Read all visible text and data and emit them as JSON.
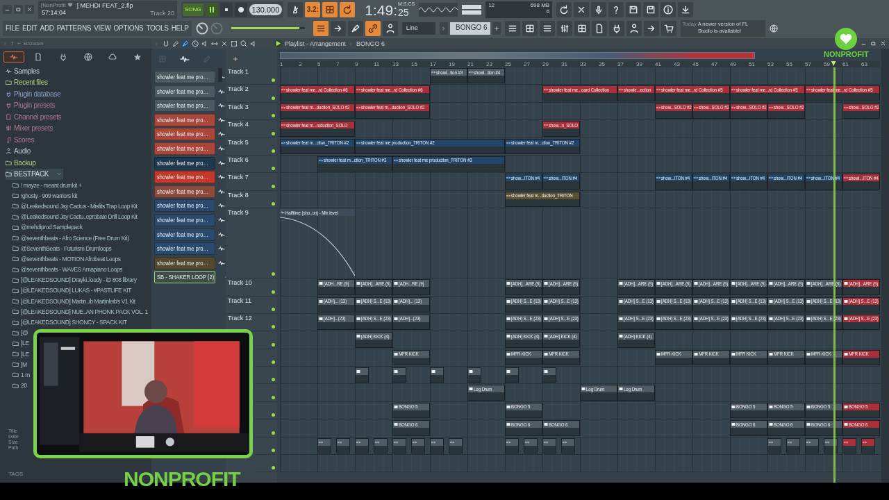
{
  "window": {
    "project": "[NonProfit",
    "elapsed": "57:14:04",
    "file": "] MEHDI FEAT_2.flp",
    "hint": "Track 20"
  },
  "window_controls": [
    {
      "kind": "minimize"
    },
    {
      "kind": "restore"
    },
    {
      "kind": "close"
    }
  ],
  "transport": {
    "mode": "SONG",
    "song_mode": true,
    "playing": true,
    "recording": false,
    "tempo": "130.000",
    "time": "1:49:",
    "time_cs": "25",
    "time_unit": "M:S:CS"
  },
  "record_tools": [
    {
      "on": false
    },
    {
      "on": true,
      "label": "3.2:"
    },
    {
      "on": true
    },
    {
      "on": true
    }
  ],
  "monitor": {
    "cpu": "12",
    "memory": "698 MB",
    "polyphony": "6"
  },
  "system_tools": [
    {
      "kind": "refresh"
    },
    {
      "kind": "scissors"
    },
    {
      "kind": "mic"
    },
    {
      "kind": "question"
    },
    {
      "kind": "disk"
    },
    {
      "kind": "disk"
    },
    {
      "kind": "info"
    },
    {
      "kind": "download"
    }
  ],
  "menu": [
    "FILE",
    "EDIT",
    "ADD",
    "PATTERNS",
    "VIEW",
    "OPTIONS",
    "TOOLS",
    "HELP"
  ],
  "master_pitch": {
    "level": 0.93
  },
  "pattern_tools": [
    {
      "on": true
    },
    {
      "on": false
    },
    {
      "on": false
    },
    {
      "on": true
    },
    {
      "on": false
    }
  ],
  "snap": "Line",
  "pattern": "BONGO 6",
  "window_tools": [
    {
      "kind": "list"
    },
    {
      "kind": "grid"
    },
    {
      "kind": "list"
    },
    {
      "kind": "sliders"
    },
    {
      "kind": "grid"
    },
    {
      "kind": "doc"
    },
    {
      "kind": "plug"
    },
    {
      "kind": "person"
    },
    {
      "kind": "arrow"
    },
    {
      "kind": "cart"
    }
  ],
  "hint": {
    "day": "Today",
    "message": "A newer version of FL Studio is available!"
  },
  "logo": {
    "text": "NONPROFIT"
  },
  "browser": {
    "title": "Browser",
    "tabs": [
      {
        "kind": "wave",
        "selected": true
      },
      {
        "kind": "doc",
        "selected": false
      },
      {
        "kind": "plug",
        "selected": false
      },
      {
        "kind": "globe",
        "selected": false
      },
      {
        "kind": "cloud",
        "selected": false
      },
      {
        "kind": "star",
        "selected": false
      }
    ],
    "items": [
      {
        "label": "Samples",
        "kind": "samples"
      },
      {
        "label": "Recent files",
        "kind": "recent"
      },
      {
        "label": "Plugin database",
        "kind": "plugin_database"
      },
      {
        "label": "Plugin presets",
        "kind": "plugin_presets"
      },
      {
        "label": "Channel presets",
        "kind": "channel_presets"
      },
      {
        "label": "Mixer presets",
        "kind": "mixer_presets"
      },
      {
        "label": "Scores",
        "kind": "scores"
      },
      {
        "label": "Audio",
        "kind": "audio"
      },
      {
        "label": "Backup",
        "kind": "backup"
      },
      {
        "label": "BESTPACK",
        "kind": "folder",
        "expanded": true,
        "children": [
          {
            "label": "! mayze - meant drumkit +"
          },
          {
            "label": "!ghosty - 909 warriors kit"
          },
          {
            "label": "@Leakedsound Jay Cactus - Misfits Trap Loop Kit"
          },
          {
            "label": "@Leakedsound Jay Cactu..eprobate Drill Loop Kit"
          },
          {
            "label": "@mehdiprod Samplepack"
          },
          {
            "label": "@seventhbeats - Afro Science (Free Drum Kit)"
          },
          {
            "label": "@SeventhBeats - Futurism Drumloops"
          },
          {
            "label": "@seventhbeats - MOTION Afrobeat Loops"
          },
          {
            "label": "@seventhbeats - WAVES Amapiano Loops"
          },
          {
            "label": "[@LEAKEDSOUND] Drayki..loody - iD 808 library"
          },
          {
            "label": "[@LEAKEDSOUND] LUKAS - #PASTLIFE KIT"
          },
          {
            "label": "[@LEAKEDSOUND] Martin..ib Martinleib's V1 Kit"
          },
          {
            "label": "[@LEAKEDSOUND] NUE..AN PHONK PACK VOL. 1"
          },
          {
            "label": "[@LEAKEDSOUND] SHONCY - SPACK KIT"
          },
          {
            "label": "[@"
          },
          {
            "label": "[LE"
          },
          {
            "label": "[LE"
          },
          {
            "label": "[M"
          },
          {
            "label": "1 m"
          },
          {
            "label": "20"
          }
        ]
      }
    ],
    "info": [
      "Title",
      "Date",
      "Size",
      "Path"
    ],
    "tags": "TAGS"
  },
  "playlist": {
    "title": "Playlist - Arrangement",
    "pattern": "BONGO 6",
    "tools": [
      {
        "kind": "magnet",
        "selected": false
      },
      {
        "kind": "pencil",
        "selected": false
      },
      {
        "kind": "brush",
        "selected": true
      },
      {
        "kind": "ban",
        "selected": false
      },
      {
        "kind": "speaker",
        "selected": false
      },
      {
        "kind": "slip",
        "selected": false
      },
      {
        "kind": "scissors",
        "selected": false
      },
      {
        "kind": "select",
        "selected": false
      },
      {
        "kind": "zoom",
        "selected": false
      },
      {
        "kind": "speaker",
        "selected": false
      }
    ],
    "ruler": [
      "1",
      "3",
      "5",
      "7",
      "9",
      "11",
      "13",
      "15",
      "17",
      "19",
      "21",
      "23",
      "25",
      "27",
      "29",
      "31",
      "33",
      "35",
      "37",
      "39",
      "41",
      "43",
      "45",
      "47",
      "49",
      "51",
      "53",
      "55",
      "57",
      "59",
      "61",
      "63"
    ],
    "playhead": {
      "level": 0.922
    },
    "channels": [
      {
        "name": "showler feat me pro…",
        "color": "#4a5a60",
        "selected": false
      },
      {
        "name": "showler feat me pro…",
        "color": "#4a5a60",
        "selected": false
      },
      {
        "name": "showler feat me pro…",
        "color": "#4a5a60",
        "selected": false
      },
      {
        "name": "showler feat me pro…",
        "color": "#a9473a",
        "selected": false
      },
      {
        "name": "showler feat me pro…",
        "color": "#a9473a",
        "selected": false
      },
      {
        "name": "showler feat me pro…",
        "color": "#a9473a",
        "selected": false
      },
      {
        "name": "showler feat me pro…",
        "color": "#1f3950",
        "selected": false
      },
      {
        "name": "showler feat me pro…",
        "color": "#c2372c",
        "selected": false
      },
      {
        "name": "showler feat me pro…",
        "color": "#8c4a3c",
        "selected": false
      },
      {
        "name": "showler feat me pro…",
        "color": "#294a6c",
        "selected": false
      },
      {
        "name": "showler feat me pro…",
        "color": "#294a6c",
        "selected": false
      },
      {
        "name": "showler feat me pro…",
        "color": "#294a6c",
        "selected": false
      },
      {
        "name": "showler feat me pro…",
        "color": "#294a6c",
        "selected": false
      },
      {
        "name": "showler feat me pro…",
        "color": "#54492f",
        "selected": false
      },
      {
        "name": "SB - SHAKER LOOP (2)",
        "color": "#3f4d4a",
        "selected": true
      }
    ],
    "tracks": [
      {
        "label": "Track 1",
        "active": true,
        "clips": [
          {
            "kind": "audio",
            "label": "showl...tion #3",
            "color": "#505c64"
          },
          {
            "kind": "audio",
            "label": "showl...tion #4",
            "color": "#505c64"
          }
        ]
      },
      {
        "label": "Track 2",
        "active": true,
        "clips": [
          {
            "kind": "audio",
            "label": "showler feat me...rd Collection #6",
            "color": "#a8303a"
          },
          {
            "kind": "audio",
            "label": "showler feat me...rd Collection #6",
            "color": "#a8303a"
          },
          {
            "kind": "audio",
            "label": "showler feat me...oard Collection",
            "color": "#a8303a"
          },
          {
            "kind": "audio",
            "label": "showle...ection",
            "color": "#a8303a"
          },
          {
            "kind": "audio",
            "label": "showler feat me...rd Collection #5",
            "color": "#a8303a"
          },
          {
            "kind": "audio",
            "label": "showler feat me...rd Collection #5",
            "color": "#a8303a"
          },
          {
            "kind": "audio",
            "label": "showler feat me...rd Collection #5",
            "color": "#a8303a"
          }
        ]
      },
      {
        "label": "Track 3",
        "active": true,
        "clips": [
          {
            "kind": "audio",
            "label": "showler feat m...duction_SOLO #2",
            "color": "#a8303a"
          },
          {
            "kind": "audio",
            "label": "showler feat m...duction_SOLO #2",
            "color": "#a8303a"
          },
          {
            "kind": "audio",
            "label": "show...SOLO #2",
            "color": "#a8303a"
          },
          {
            "kind": "audio",
            "label": "show...SOLO #2",
            "color": "#a8303a"
          },
          {
            "kind": "audio",
            "label": "show...SOLO #2",
            "color": "#a8303a"
          },
          {
            "kind": "audio",
            "label": "show...SOLO #2",
            "color": "#a8303a"
          },
          {
            "kind": "audio",
            "label": "show...SOLO #2",
            "color": "#a8303a"
          }
        ]
      },
      {
        "label": "Track 4",
        "active": true,
        "clips": [
          {
            "kind": "audio",
            "label": "showler feat m...roduction_SOLO",
            "color": "#a8303a"
          },
          {
            "kind": "audio",
            "label": "show...n_SOLO",
            "color": "#a8303a"
          }
        ]
      },
      {
        "label": "Track 5",
        "active": true,
        "clips": [
          {
            "kind": "audio",
            "label": "showler feat m...ction_TRITON #2",
            "color": "#22456a"
          },
          {
            "kind": "audio",
            "label": "showler feat me production_TRITON #2",
            "color": "#22456a"
          },
          {
            "kind": "audio",
            "label": "showler feat m...ction_TRITON #2",
            "color": "#22456a"
          }
        ]
      },
      {
        "label": "Track 6",
        "active": true,
        "clips": [
          {
            "kind": "audio",
            "label": "showler feat m...ction_TRITON #3",
            "color": "#22456a"
          },
          {
            "kind": "audio",
            "label": "showler feat me production_TRITON #3",
            "color": "#22456a"
          }
        ]
      },
      {
        "label": "Track 7",
        "active": true,
        "clips": [
          {
            "kind": "audio",
            "label": "show...ITON #4",
            "color": "#22456a"
          },
          {
            "kind": "audio",
            "label": "show...ITON #4",
            "color": "#22456a"
          },
          {
            "kind": "audio",
            "label": "show...ITON #4",
            "color": "#22456a"
          },
          {
            "kind": "audio",
            "label": "show...ITON #4",
            "color": "#22456a"
          },
          {
            "kind": "audio",
            "label": "show...ITON #4",
            "color": "#22456a"
          },
          {
            "kind": "audio",
            "label": "show...ITON #4",
            "color": "#22456a"
          },
          {
            "kind": "audio",
            "label": "show...ITON #4",
            "color": "#22456a"
          },
          {
            "kind": "audio",
            "label": "showl...ITON #4",
            "color": "#a8303a"
          }
        ]
      },
      {
        "label": "Track 8",
        "active": true,
        "clips": [
          {
            "kind": "audio",
            "label": "showler feat m...duction_TRITON",
            "color": "#5e5034"
          }
        ]
      },
      {
        "label": "Track 9",
        "kind": "automation",
        "active": true,
        "clips": [
          {
            "kind": "automation",
            "label": "Halftime (sho..on) - Mix level",
            "color": "#3c4c58"
          }
        ]
      },
      {
        "label": "Track 10",
        "active": true,
        "clips": [
          {
            "kind": "pattern",
            "label": "[ADH...RE (9)",
            "color": "#505c64"
          },
          {
            "kind": "pattern",
            "label": "[ADH]...ARE (9)",
            "color": "#505c64"
          },
          {
            "kind": "pattern",
            "label": "[ADH...RE (9)",
            "color": "#505c64"
          },
          {
            "kind": "pattern",
            "label": "[ADH]...ARE (9)",
            "color": "#505c64"
          },
          {
            "kind": "pattern",
            "label": "[ADH]...ARE (9)",
            "color": "#505c64"
          },
          {
            "kind": "pattern",
            "label": "[ADH]...ARE (9)",
            "color": "#505c64"
          },
          {
            "kind": "pattern",
            "label": "[ADH]...ARE (9)",
            "color": "#505c64"
          },
          {
            "kind": "pattern",
            "label": "[ADH]...ARE (9)",
            "color": "#505c64"
          },
          {
            "kind": "pattern",
            "label": "[ADH]...ARE (9)",
            "color": "#505c64"
          },
          {
            "kind": "pattern",
            "label": "[ADH]...ARE (9)",
            "color": "#505c64"
          },
          {
            "kind": "pattern",
            "label": "[ADH]...ARE (9)",
            "color": "#505c64"
          },
          {
            "kind": "pattern",
            "label": "[ADH]...ARE (9)",
            "color": "#a8303a"
          }
        ]
      },
      {
        "label": "Track 11",
        "active": true,
        "clips": [
          {
            "kind": "pattern",
            "label": "[ADH]... (13)",
            "color": "#505c64"
          },
          {
            "kind": "pattern",
            "label": "[ADH] S...E (13)",
            "color": "#505c64"
          },
          {
            "kind": "pattern",
            "label": "[ADH]... (13)",
            "color": "#505c64"
          },
          {
            "kind": "pattern",
            "label": "[ADH] S...E (13)",
            "color": "#505c64"
          },
          {
            "kind": "pattern",
            "label": "[ADH] S...E (13)",
            "color": "#505c64"
          },
          {
            "kind": "pattern",
            "label": "[ADH] S...E (13)",
            "color": "#505c64"
          },
          {
            "kind": "pattern",
            "label": "[ADH] S...E (13)",
            "color": "#505c64"
          },
          {
            "kind": "pattern",
            "label": "[ADH] S...E (13)",
            "color": "#505c64"
          },
          {
            "kind": "pattern",
            "label": "[ADH] S...E (13)",
            "color": "#505c64"
          },
          {
            "kind": "pattern",
            "label": "[ADH] S...E (13)",
            "color": "#505c64"
          },
          {
            "kind": "pattern",
            "label": "[ADH] S...E (13)",
            "color": "#505c64"
          },
          {
            "kind": "pattern",
            "label": "[ADH] S...E (13)",
            "color": "#a8303a"
          }
        ]
      },
      {
        "label": "Track 12",
        "active": true,
        "clips": [
          {
            "kind": "pattern",
            "label": "[ADH]...(23)",
            "color": "#505c64"
          },
          {
            "kind": "pattern",
            "label": "[ADH] S...E (23)",
            "color": "#505c64"
          },
          {
            "kind": "pattern",
            "label": "[ADH]...(23)",
            "color": "#505c64"
          },
          {
            "kind": "pattern",
            "label": "[ADH] S...E (23)",
            "color": "#505c64"
          },
          {
            "kind": "pattern",
            "label": "[ADH] S...E (23)",
            "color": "#505c64"
          },
          {
            "kind": "pattern",
            "label": "[ADH] S...E (23)",
            "color": "#505c64"
          },
          {
            "kind": "pattern",
            "label": "[ADH] S...E (23)",
            "color": "#505c64"
          },
          {
            "kind": "pattern",
            "label": "[ADH] S...E (23)",
            "color": "#505c64"
          },
          {
            "kind": "pattern",
            "label": "[ADH] S...E (23)",
            "color": "#505c64"
          },
          {
            "kind": "pattern",
            "label": "[ADH] S...E (23)",
            "color": "#505c64"
          },
          {
            "kind": "pattern",
            "label": "[ADH] S...E (23)",
            "color": "#505c64"
          },
          {
            "kind": "pattern",
            "label": "[ADH] S...E (23)",
            "color": "#a8303a"
          }
        ]
      },
      {
        "active": true,
        "clips": [
          {
            "kind": "pattern",
            "label": "[ADH] KICK (4)",
            "color": "#505c64"
          },
          {
            "kind": "pattern",
            "label": "[ADH] KICK (4)",
            "color": "#505c64"
          },
          {
            "kind": "pattern",
            "label": "[ADH] KICK (4)",
            "color": "#505c64"
          },
          {
            "kind": "pattern",
            "label": "[ADH] KICK (4)",
            "color": "#505c64"
          }
        ]
      },
      {
        "active": true,
        "clips": [
          {
            "kind": "pattern",
            "label": "MFR KICK",
            "color": "#505c64"
          },
          {
            "kind": "pattern",
            "label": "MFR KICK",
            "color": "#505c64"
          },
          {
            "kind": "pattern",
            "label": "MFR KICK",
            "color": "#505c64"
          },
          {
            "kind": "pattern",
            "label": "MFR KICK",
            "color": "#505c64"
          },
          {
            "kind": "pattern",
            "label": "MFR KICK",
            "color": "#505c64"
          },
          {
            "kind": "pattern",
            "label": "MFR KICK",
            "color": "#505c64"
          },
          {
            "kind": "pattern",
            "label": "MFR KICK",
            "color": "#505c64"
          },
          {
            "kind": "pattern",
            "label": "MFR KICK",
            "color": "#505c64"
          },
          {
            "kind": "pattern",
            "label": "MFR KICK",
            "color": "#a8303a"
          }
        ]
      },
      {
        "active": true,
        "clips": [
          {
            "kind": "pattern",
            "color": "#505c64"
          },
          {
            "kind": "pattern",
            "color": "#505c64"
          },
          {
            "kind": "pattern",
            "color": "#505c64"
          },
          {
            "kind": "pattern",
            "color": "#505c64"
          },
          {
            "kind": "pattern",
            "color": "#505c64"
          },
          {
            "kind": "pattern",
            "color": "#505c64"
          }
        ]
      },
      {
        "active": true,
        "clips": [
          {
            "kind": "pattern",
            "label": "Log Drum",
            "color": "#505c64"
          },
          {
            "kind": "pattern",
            "label": "Log Drum",
            "color": "#505c64"
          },
          {
            "kind": "pattern",
            "label": "Log Drum",
            "color": "#505c64"
          }
        ]
      },
      {
        "active": true,
        "clips": [
          {
            "kind": "pattern",
            "label": "BONGO 5",
            "color": "#505c64"
          },
          {
            "kind": "pattern",
            "label": "BONGO 5",
            "color": "#505c64"
          },
          {
            "kind": "pattern",
            "label": "BONGO 5",
            "color": "#505c64"
          },
          {
            "kind": "pattern",
            "label": "BONGO 5",
            "color": "#505c64"
          },
          {
            "kind": "pattern",
            "label": "BONGO 5",
            "color": "#505c64"
          },
          {
            "kind": "pattern",
            "label": "BONGO 5",
            "color": "#a8303a"
          }
        ]
      },
      {
        "active": true,
        "clips": [
          {
            "kind": "pattern",
            "label": "BONGO 6",
            "color": "#505c64"
          },
          {
            "kind": "pattern",
            "label": "BONGO 6",
            "color": "#505c64"
          },
          {
            "kind": "pattern",
            "label": "BONGO 6",
            "color": "#505c64"
          },
          {
            "kind": "pattern",
            "label": "BONGO 6",
            "color": "#505c64"
          },
          {
            "kind": "pattern",
            "label": "BONGO 6",
            "color": "#505c64"
          },
          {
            "kind": "pattern",
            "label": "BONGO 6",
            "color": "#505c64"
          },
          {
            "kind": "pattern",
            "label": "BONGO 6",
            "color": "#a8303a"
          }
        ]
      },
      {
        "active": true,
        "clips": [
          {
            "kind": "audio",
            "color": "#505c64"
          },
          {
            "kind": "audio",
            "color": "#505c64"
          },
          {
            "kind": "audio",
            "color": "#505c64"
          },
          {
            "kind": "audio",
            "color": "#505c64"
          },
          {
            "kind": "audio",
            "color": "#505c64"
          },
          {
            "kind": "audio",
            "color": "#505c64"
          },
          {
            "kind": "audio",
            "color": "#505c64"
          },
          {
            "kind": "audio",
            "color": "#505c64"
          },
          {
            "kind": "audio",
            "color": "#505c64"
          },
          {
            "kind": "audio",
            "color": "#505c64"
          },
          {
            "kind": "audio",
            "color": "#505c64"
          },
          {
            "kind": "audio",
            "color": "#505c64"
          },
          {
            "kind": "audio",
            "color": "#505c64"
          },
          {
            "kind": "audio",
            "color": "#505c64"
          },
          {
            "kind": "audio",
            "color": "#505c64"
          },
          {
            "kind": "audio",
            "color": "#505c64"
          },
          {
            "kind": "audio",
            "color": "#a8303a"
          },
          {
            "kind": "audio",
            "color": "#a8303a"
          }
        ]
      },
      {
        "active": true
      }
    ]
  },
  "webcam": {
    "kind": "picture",
    "caption": "NONPROFIT"
  }
}
